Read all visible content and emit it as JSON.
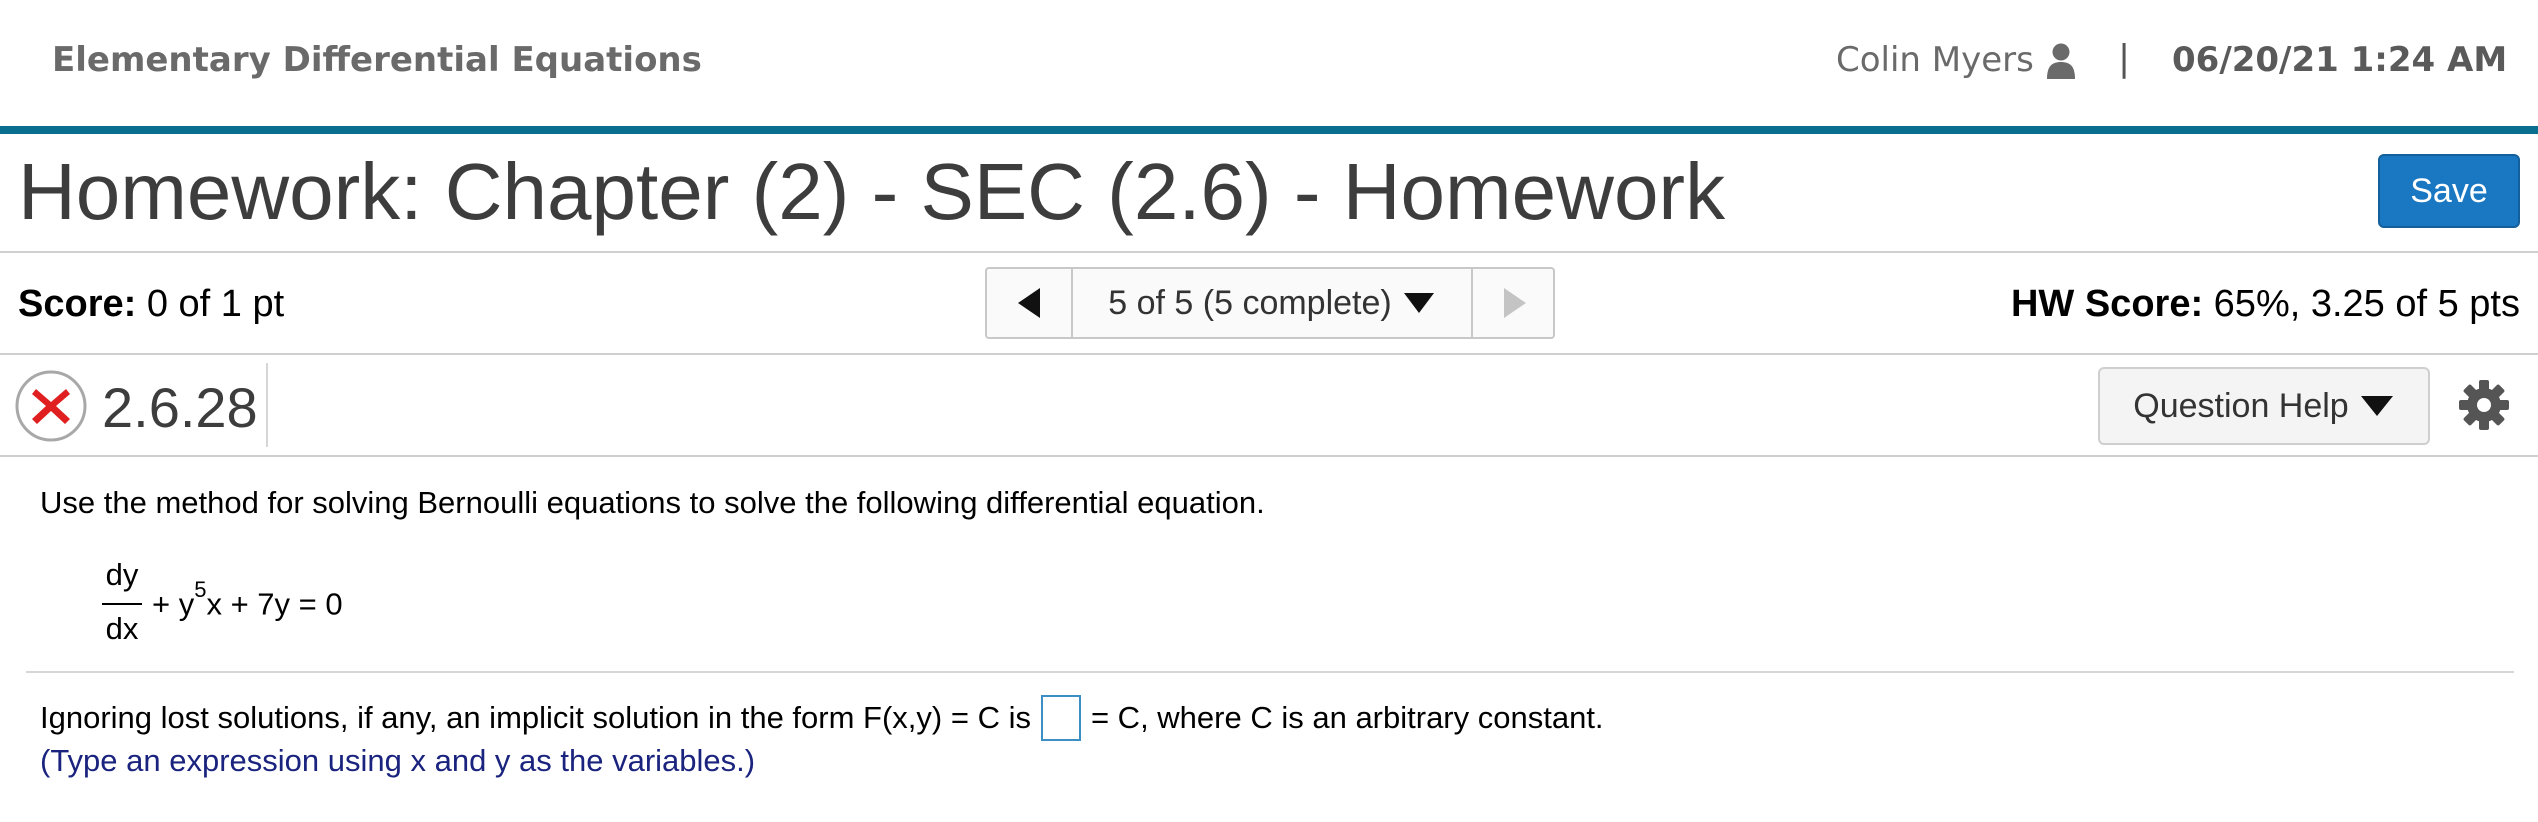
{
  "header": {
    "course_title": "Elementary Differential Equations",
    "user_name": "Colin Myers",
    "separator": "|",
    "datetime": "06/20/21 1:24 AM"
  },
  "assignment": {
    "title": "Homework: Chapter (2) - SEC (2.6) - Homework",
    "save_label": "Save"
  },
  "scores": {
    "score_label": "Score:",
    "score_value": "0 of 1 pt",
    "nav_label": "5 of 5 (5 complete)",
    "hw_score_label": "HW Score:",
    "hw_score_value": "65%, 3.25 of 5 pts"
  },
  "question": {
    "status": "incorrect",
    "number": "2.6.28",
    "help_label": "Question Help",
    "prompt": "Use the method for solving Bernoulli equations to solve the following differential equation.",
    "equation": {
      "numerator": "dy",
      "denominator": "dx",
      "term_plus_y": "+ y",
      "exponent": "5",
      "rest": "x + 7y = 0"
    },
    "answer_prefix": "Ignoring lost solutions, if any, an implicit solution in the form F(x,y) = C is",
    "answer_value": "",
    "answer_suffix": "= C, where C is an arbitrary constant.",
    "hint": "(Type an expression using x and y as the variables.)"
  },
  "colors": {
    "accent_bar": "#0a6e8f",
    "save_button": "#1a78c2",
    "incorrect_red": "#e02020",
    "hint_text": "#1a237e"
  }
}
